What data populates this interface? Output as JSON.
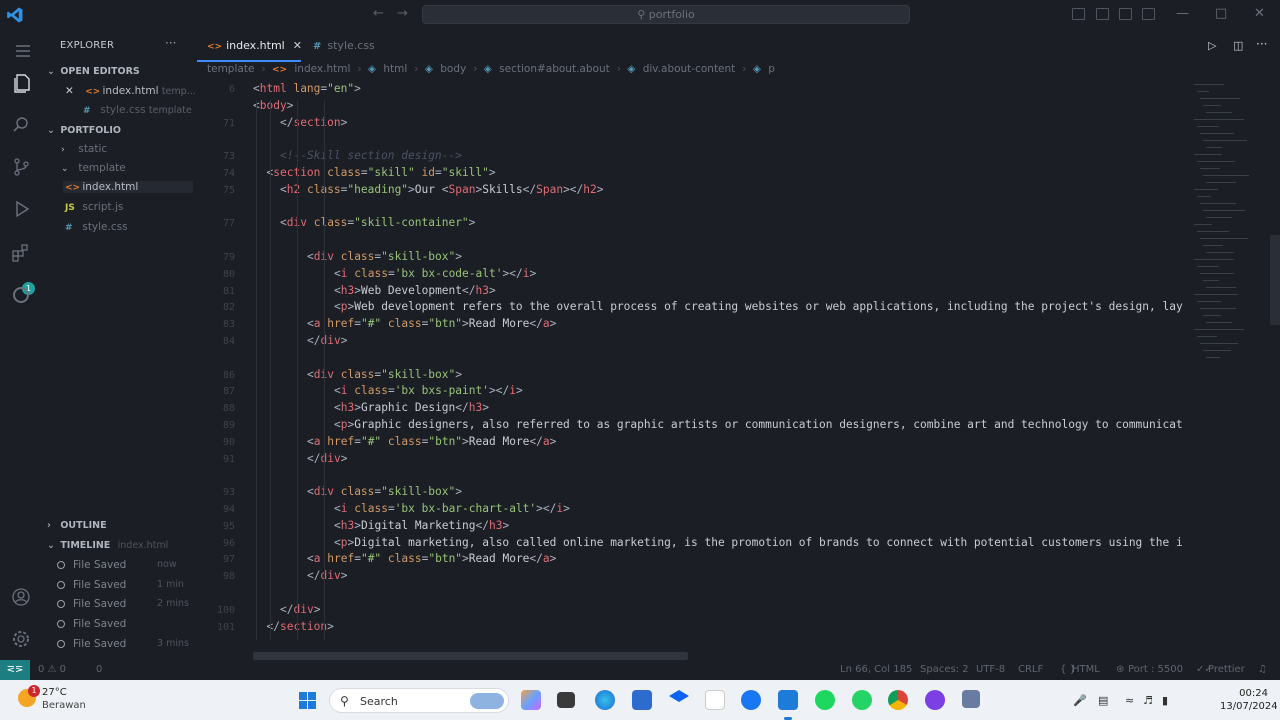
{
  "window": {
    "search_text": "portfolio"
  },
  "sidebar": {
    "title": "EXPLORER",
    "open_editors_label": "OPEN EDITORS",
    "open_editors": [
      {
        "name": "index.html",
        "folder": "temp..."
      },
      {
        "name": "style.css",
        "folder": "template"
      }
    ],
    "project_label": "PORTFOLIO",
    "tree": [
      {
        "name": "static",
        "type": "folder",
        "expanded": false
      },
      {
        "name": "template",
        "type": "folder",
        "expanded": true
      },
      {
        "name": "index.html",
        "type": "html"
      },
      {
        "name": "script.js",
        "type": "js"
      },
      {
        "name": "style.css",
        "type": "css"
      }
    ],
    "outline_label": "OUTLINE",
    "timeline_label": "TIMELINE",
    "timeline_file": "index.html",
    "timeline": [
      {
        "label": "File Saved",
        "when": "now"
      },
      {
        "label": "File Saved",
        "when": "1 min"
      },
      {
        "label": "File Saved",
        "when": "2 mins"
      },
      {
        "label": "File Saved",
        "when": ""
      },
      {
        "label": "File Saved",
        "when": "3 mins"
      }
    ]
  },
  "tabs": [
    {
      "label": "index.html",
      "active": true
    },
    {
      "label": "style.css",
      "active": false
    }
  ],
  "breadcrumb": [
    "template",
    "index.html",
    "html",
    "body",
    "section#about.about",
    "div.about-content",
    "p"
  ],
  "code_lines": [
    {
      "n": "6",
      "indent": 0,
      "html": "<span class='p'>&lt;</span><span class='t'>html</span> <span class='a'>lang</span><span class='p'>=</span><span class='s'>\"en\"</span><span class='p'>&gt;</span>"
    },
    {
      "n": "",
      "indent": 0,
      "html": "<span class='p'>&lt;</span><span class='t'>body</span><span class='p'>&gt;</span>"
    },
    {
      "n": "71",
      "indent": 2,
      "html": "<span class='p'>&lt;/</span><span class='t'>section</span><span class='p'>&gt;</span>"
    },
    {
      "n": "",
      "indent": 0,
      "html": ""
    },
    {
      "n": "73",
      "indent": 2,
      "html": "<span class='c'>&lt;!--Skill section design--&gt;</span>"
    },
    {
      "n": "74",
      "indent": 1,
      "html": "<span class='p'>&lt;</span><span class='t'>section</span> <span class='a'>class</span><span class='p'>=</span><span class='s'>\"skill\"</span> <span class='a'>id</span><span class='p'>=</span><span class='s'>\"skill\"</span><span class='p'>&gt;</span>"
    },
    {
      "n": "75",
      "indent": 2,
      "html": "<span class='p'>&lt;</span><span class='t'>h2</span> <span class='a'>class</span><span class='p'>=</span><span class='s'>\"heading\"</span><span class='p'>&gt;</span><span class='tx'>Our </span><span class='p'>&lt;</span><span class='t'>Span</span><span class='p'>&gt;</span><span class='tx'>Skills</span><span class='p'>&lt;/</span><span class='t'>Span</span><span class='p'>&gt;&lt;/</span><span class='t'>h2</span><span class='p'>&gt;</span>"
    },
    {
      "n": "",
      "indent": 0,
      "html": ""
    },
    {
      "n": "77",
      "indent": 2,
      "html": "<span class='p'>&lt;</span><span class='t'>div</span> <span class='a'>class</span><span class='p'>=</span><span class='s'>\"skill-container\"</span><span class='p'>&gt;</span>"
    },
    {
      "n": "",
      "indent": 0,
      "html": ""
    },
    {
      "n": "79",
      "indent": 4,
      "html": "<span class='p'>&lt;</span><span class='t'>div</span> <span class='a'>class</span><span class='p'>=</span><span class='s'>\"skill-box\"</span><span class='p'>&gt;</span>"
    },
    {
      "n": "80",
      "indent": 6,
      "html": "<span class='p'>&lt;</span><span class='t'>i</span> <span class='a'>class</span><span class='p'>=</span><span class='s'>'bx bx-code-alt'</span><span class='p'>&gt;&lt;/</span><span class='t'>i</span><span class='p'>&gt;</span>"
    },
    {
      "n": "81",
      "indent": 6,
      "html": "<span class='p'>&lt;</span><span class='t'>h3</span><span class='p'>&gt;</span><span class='tx'>Web Development</span><span class='p'>&lt;/</span><span class='t'>h3</span><span class='p'>&gt;</span>"
    },
    {
      "n": "82",
      "indent": 6,
      "html": "<span class='p'>&lt;</span><span class='t'>p</span><span class='p'>&gt;</span><span class='tx'>Web development refers to the overall process of creating websites or web applications, including the project's design, lay</span>"
    },
    {
      "n": "83",
      "indent": 4,
      "html": "<span class='p'>&lt;</span><span class='t'>a</span> <span class='a'>href</span><span class='p'>=</span><span class='s'>\"#\"</span> <span class='a'>class</span><span class='p'>=</span><span class='s'>\"btn\"</span><span class='p'>&gt;</span><span class='tx'>Read More</span><span class='p'>&lt;/</span><span class='t'>a</span><span class='p'>&gt;</span>"
    },
    {
      "n": "84",
      "indent": 4,
      "html": "<span class='p'>&lt;/</span><span class='t'>div</span><span class='p'>&gt;</span>"
    },
    {
      "n": "",
      "indent": 0,
      "html": ""
    },
    {
      "n": "86",
      "indent": 4,
      "html": "<span class='p'>&lt;</span><span class='t'>div</span> <span class='a'>class</span><span class='p'>=</span><span class='s'>\"skill-box\"</span><span class='p'>&gt;</span>"
    },
    {
      "n": "87",
      "indent": 6,
      "html": "<span class='p'>&lt;</span><span class='t'>i</span> <span class='a'>class</span><span class='p'>=</span><span class='s'>'bx bxs-paint'</span><span class='p'>&gt;&lt;/</span><span class='t'>i</span><span class='p'>&gt;</span>"
    },
    {
      "n": "88",
      "indent": 6,
      "html": "<span class='p'>&lt;</span><span class='t'>h3</span><span class='p'>&gt;</span><span class='tx'>Graphic Design</span><span class='p'>&lt;/</span><span class='t'>h3</span><span class='p'>&gt;</span>"
    },
    {
      "n": "89",
      "indent": 6,
      "html": "<span class='p'>&lt;</span><span class='t'>p</span><span class='p'>&gt;</span><span class='tx'>Graphic designers, also referred to as graphic artists or communication designers, combine art and technology to communicat</span>"
    },
    {
      "n": "90",
      "indent": 4,
      "html": "<span class='p'>&lt;</span><span class='t'>a</span> <span class='a'>href</span><span class='p'>=</span><span class='s'>\"#\"</span> <span class='a'>class</span><span class='p'>=</span><span class='s'>\"btn\"</span><span class='p'>&gt;</span><span class='tx'>Read More</span><span class='p'>&lt;/</span><span class='t'>a</span><span class='p'>&gt;</span>"
    },
    {
      "n": "91",
      "indent": 4,
      "html": "<span class='p'>&lt;/</span><span class='t'>div</span><span class='p'>&gt;</span>"
    },
    {
      "n": "",
      "indent": 0,
      "html": ""
    },
    {
      "n": "93",
      "indent": 4,
      "html": "<span class='p'>&lt;</span><span class='t'>div</span> <span class='a'>class</span><span class='p'>=</span><span class='s'>\"skill-box\"</span><span class='p'>&gt;</span>"
    },
    {
      "n": "94",
      "indent": 6,
      "html": "<span class='p'>&lt;</span><span class='t'>i</span> <span class='a'>class</span><span class='p'>=</span><span class='s'>'bx bx-bar-chart-alt'</span><span class='p'>&gt;&lt;/</span><span class='t'>i</span><span class='p'>&gt;</span>"
    },
    {
      "n": "95",
      "indent": 6,
      "html": "<span class='p'>&lt;</span><span class='t'>h3</span><span class='p'>&gt;</span><span class='tx'>Digital Marketing</span><span class='p'>&lt;/</span><span class='t'>h3</span><span class='p'>&gt;</span>"
    },
    {
      "n": "96",
      "indent": 6,
      "html": "<span class='p'>&lt;</span><span class='t'>p</span><span class='p'>&gt;</span><span class='tx'>Digital marketing, also called online marketing, is the promotion of brands to connect with potential customers using the i</span>"
    },
    {
      "n": "97",
      "indent": 4,
      "html": "<span class='p'>&lt;</span><span class='t'>a</span> <span class='a'>href</span><span class='p'>=</span><span class='s'>\"#\"</span> <span class='a'>class</span><span class='p'>=</span><span class='s'>\"btn\"</span><span class='p'>&gt;</span><span class='tx'>Read More</span><span class='p'>&lt;/</span><span class='t'>a</span><span class='p'>&gt;</span>"
    },
    {
      "n": "98",
      "indent": 4,
      "html": "<span class='p'>&lt;/</span><span class='t'>div</span><span class='p'>&gt;</span>"
    },
    {
      "n": "",
      "indent": 0,
      "html": ""
    },
    {
      "n": "100",
      "indent": 2,
      "html": "<span class='p'>&lt;/</span><span class='t'>div</span><span class='p'>&gt;</span>"
    },
    {
      "n": "101",
      "indent": 1,
      "html": "<span class='p'>&lt;/</span><span class='t'>section</span><span class='p'>&gt;</span>"
    }
  ],
  "status": {
    "problems": "0 ⚠ 0",
    "ports": "0",
    "position": "Ln 66, Col 185",
    "spaces": "Spaces: 2",
    "encoding": "UTF-8",
    "eol": "CRLF",
    "language": "HTML",
    "port": "Port : 5500",
    "formatter": "Prettier"
  },
  "taskbar": {
    "temperature": "27°C",
    "condition": "Berawan",
    "weather_badge": "1",
    "search_label": "Search",
    "time": "00:24",
    "date": "13/07/2024"
  },
  "colors": {
    "accent": "#3f8ef7",
    "remote": "#1d7e82",
    "background": "#1b1e24"
  }
}
